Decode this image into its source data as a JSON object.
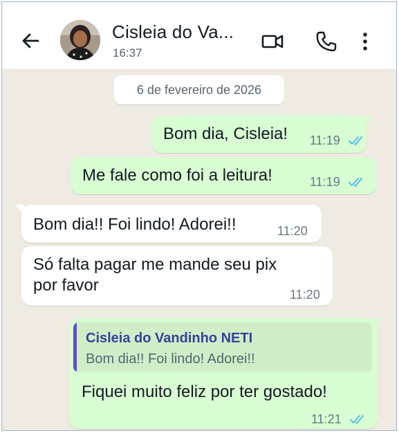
{
  "header": {
    "contact_name": "Cisleia do Va...",
    "last_seen": "16:37",
    "icons": [
      "back-arrow-icon",
      "video-call-icon",
      "voice-call-icon",
      "more-options-icon"
    ]
  },
  "date_divider": "6 de fevereiro de 2026",
  "messages": [
    {
      "direction": "outgoing",
      "text": "Bom dia, Cisleia!",
      "time": "11:19",
      "status": "read"
    },
    {
      "direction": "outgoing",
      "text": "Me fale como foi a leitura!",
      "time": "11:19",
      "status": "read"
    },
    {
      "direction": "incoming",
      "text": "Bom dia!! Foi lindo! Adorei!!",
      "time": "11:20"
    },
    {
      "direction": "incoming",
      "lines": [
        "Só falta pagar me mande seu pix",
        "por favor"
      ],
      "time": "11:20"
    },
    {
      "direction": "outgoing",
      "quote": {
        "author": "Cisleia do Vandinho NETI",
        "text": "Bom dia!! Foi lindo! Adorei!!"
      },
      "text": "Fiquei muito feliz por ter gostado!",
      "time": "11:21",
      "status": "read"
    }
  ],
  "colors": {
    "chat_background": "#efeae2",
    "outgoing_bubble": "#d9fdd3",
    "incoming_bubble": "#ffffff",
    "read_ticks": "#53bdeb",
    "quote_bar": "#5a4fc8"
  }
}
